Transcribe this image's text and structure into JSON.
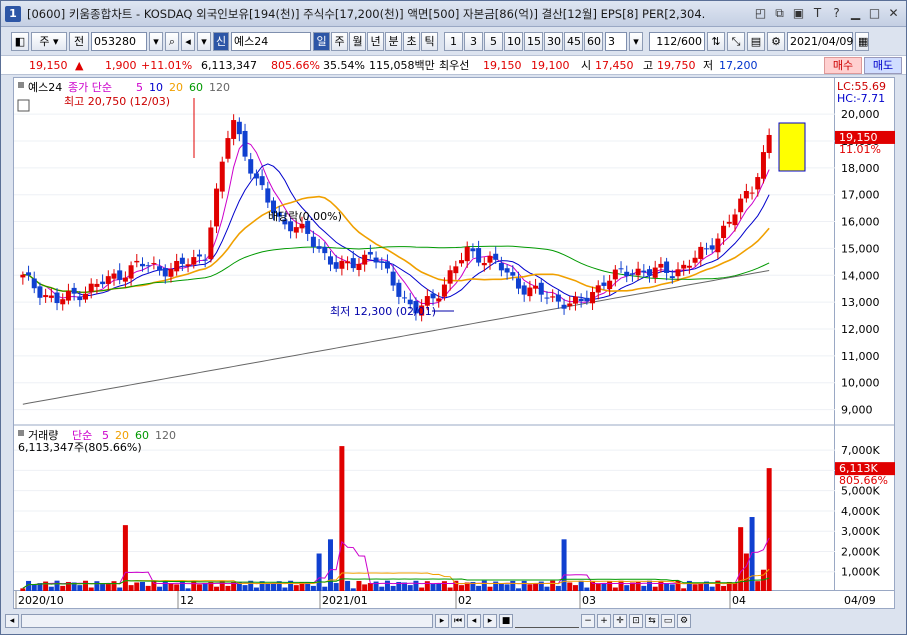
{
  "window": {
    "number": "1",
    "title": "[0600] 키움종합차트 - KOSDAQ 외국인보유[194(천)] 주식수[17,200(천)] 액면[500] 자본금[86(억)] 결산[12월] EPS[8] PER[2,304."
  },
  "toolbar": {
    "type": "주",
    "market": "전",
    "code": "053280",
    "name": "예스24",
    "badge": "신",
    "periods": [
      "일",
      "주",
      "월",
      "년",
      "분",
      "초",
      "틱"
    ],
    "intervals": [
      "1",
      "3",
      "5",
      "10",
      "15",
      "30",
      "45",
      "60"
    ],
    "interval_value": "3",
    "count": "112/600",
    "date": "2021/04/09"
  },
  "info": {
    "price": "19,150",
    "change_arrow": "▲",
    "change": "1,900",
    "change_pct": "+11.01%",
    "volume": "6,113,347",
    "volume_pct": "805.66%",
    "rate": "35.54%",
    "amount": "115,058백만",
    "best_label": "최우선",
    "bid1": "19,150",
    "bid2": "19,100",
    "open_label": "시",
    "open": "17,450",
    "high_label": "고",
    "high": "19,750",
    "low_label": "저",
    "low": "17,200",
    "buy": "매수",
    "sell": "매도"
  },
  "price_panel": {
    "legend_name": "예스24",
    "legend_ma": "종가 단순",
    "ma_periods": [
      "5",
      "10",
      "20",
      "60",
      "120"
    ],
    "ma_colors": [
      "#cc00cc",
      "#0000cc",
      "#f0a000",
      "#009900",
      "#666666"
    ],
    "high_note": "최고 20,750 (12/03)",
    "low_note": "최저 12,300 (02/01)",
    "dividend_note": "배당락(0.00%)",
    "lc": "LC:55.69",
    "hc": "HC:-7.71",
    "last_price": "19,150",
    "last_pct": "11.01%",
    "y_ticks": [
      "20,000",
      "19,000",
      "18,000",
      "17,000",
      "16,000",
      "15,000",
      "14,000",
      "13,000",
      "12,000",
      "11,000",
      "10,000",
      "9,000"
    ]
  },
  "volume_panel": {
    "legend": "거래량",
    "legend_ma": "단순",
    "ma_periods": [
      "5",
      "20",
      "60",
      "120"
    ],
    "last_volume": "6,113,347주(805.66%)",
    "last_badge": "6,113K",
    "last_pct": "805.66%",
    "y_ticks": [
      "7,000K",
      "6,000K",
      "5,000K",
      "4,000K",
      "3,000K",
      "2,000K",
      "1,000K"
    ]
  },
  "x_axis": {
    "labels": [
      "2020/10",
      "12",
      "2021/01",
      "02",
      "03",
      "04"
    ],
    "right_label": "04/09"
  },
  "colors": {
    "up": "#e00000",
    "down": "#1040d0"
  }
}
